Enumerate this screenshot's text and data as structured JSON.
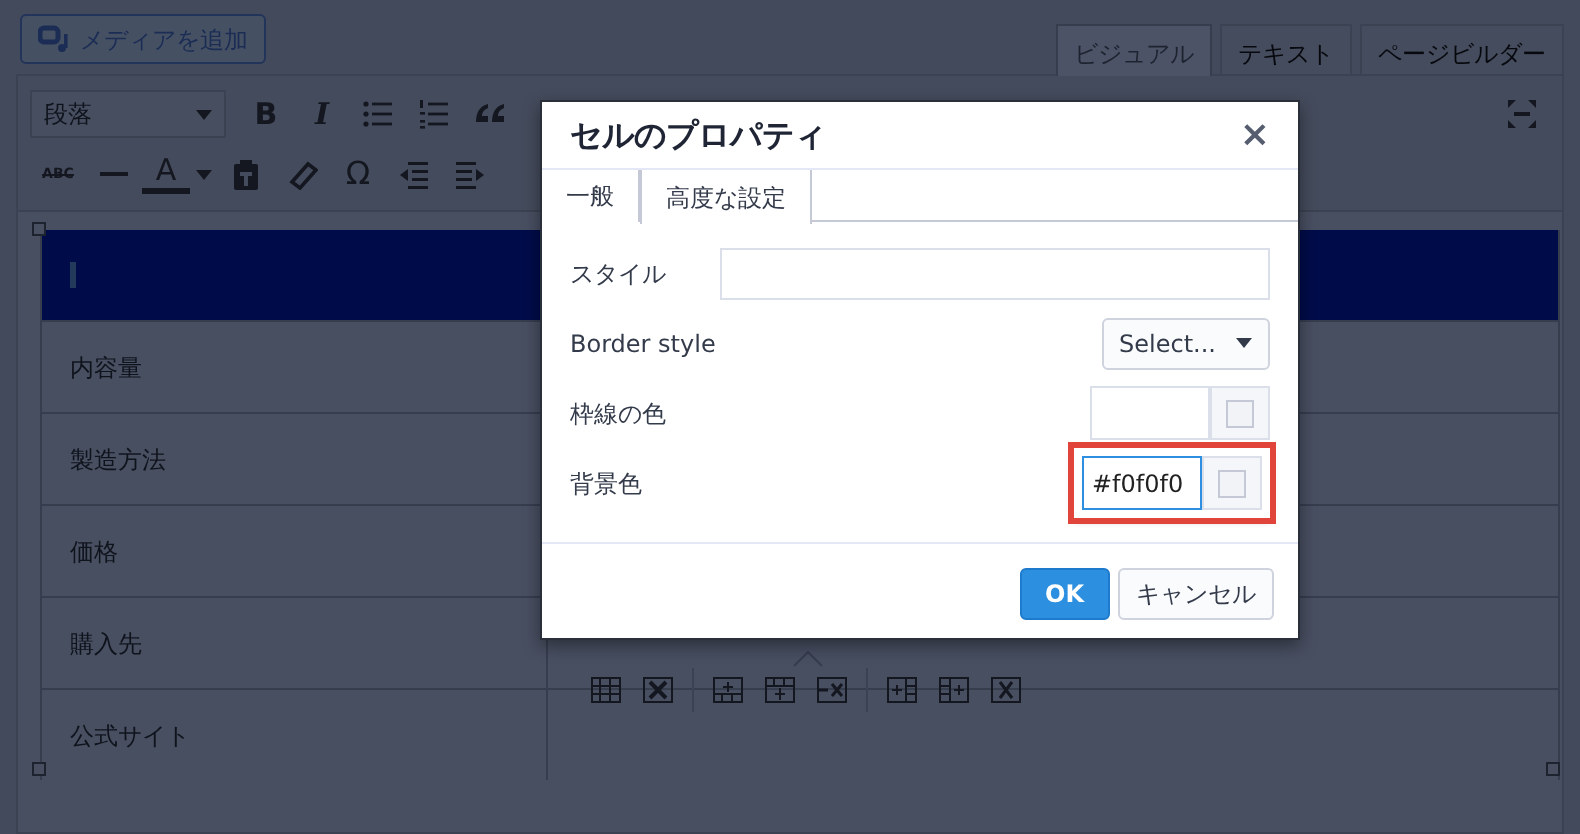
{
  "add_media_button": {
    "label": "メディアを追加"
  },
  "editor_tabs": [
    {
      "label": "ビジュアル",
      "selected": true
    },
    {
      "label": "テキスト",
      "selected": false
    },
    {
      "label": "ページビルダー",
      "selected": false
    }
  ],
  "toolbar": {
    "format": "段落",
    "glyphs": [
      "B",
      "I",
      "ABC",
      "A",
      "Ω"
    ]
  },
  "table": {
    "rows": [
      {
        "label": "内容量"
      },
      {
        "label": "製造方法"
      },
      {
        "label": "価格"
      },
      {
        "label": "購入先"
      },
      {
        "label": "公式サイト"
      }
    ]
  },
  "dialog": {
    "title": "セルのプロパティ",
    "close": "×",
    "tabs": [
      {
        "label": "一般",
        "selected": false
      },
      {
        "label": "高度な設定",
        "selected": true
      }
    ],
    "fields": [
      {
        "kind": "text",
        "label": "スタイル"
      },
      {
        "kind": "select",
        "label": "Border style",
        "value": "Select..."
      },
      {
        "kind": "color",
        "label": "枠線の色",
        "highlighted": false
      },
      {
        "kind": "color",
        "label": "背景色",
        "value": "#f0f0f0",
        "highlighted": true
      }
    ],
    "buttons": [
      {
        "label": "OK",
        "kind": "primary"
      },
      {
        "label": "キャンセル",
        "kind": "default"
      }
    ]
  }
}
